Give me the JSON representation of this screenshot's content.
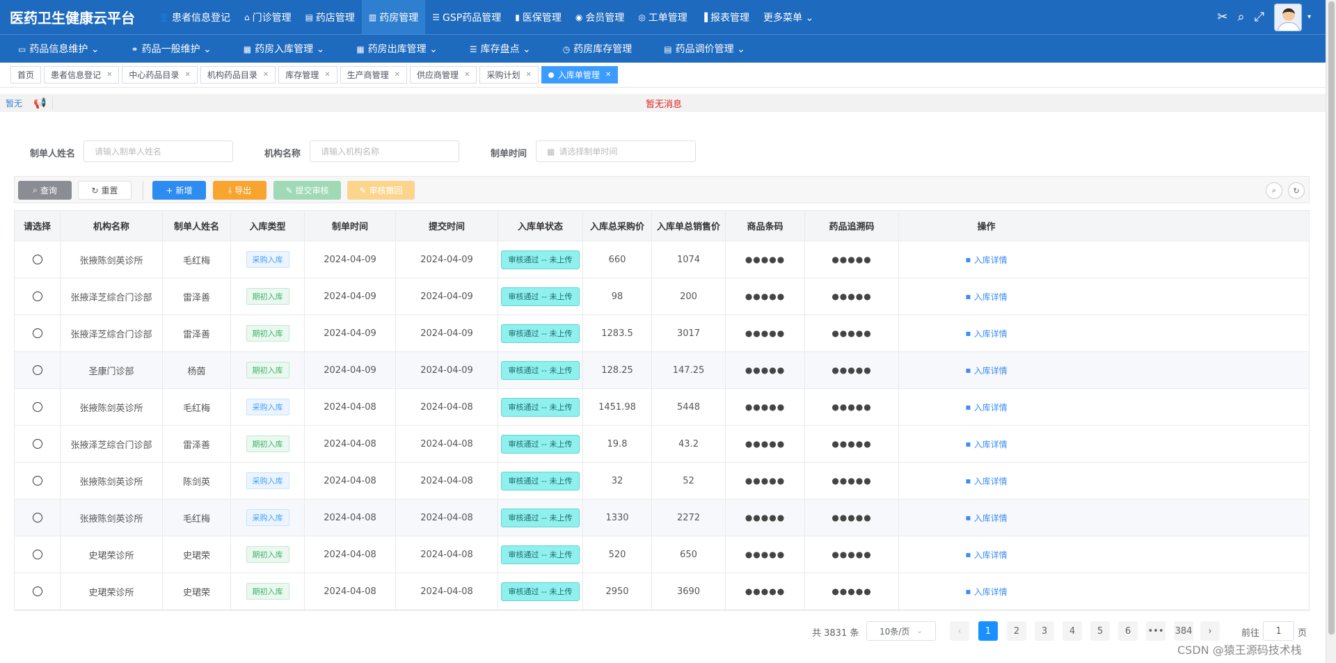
{
  "app": {
    "title": "医药卫生健康云平台"
  },
  "topnav": [
    {
      "icon": "user-icon",
      "glyph": "👤",
      "label": "患者信息登记"
    },
    {
      "icon": "clinic-icon",
      "glyph": "⌂",
      "label": "门诊管理"
    },
    {
      "icon": "store-icon",
      "glyph": "▤",
      "label": "药店管理"
    },
    {
      "icon": "pharmacy-icon",
      "glyph": "▥",
      "label": "药房管理"
    },
    {
      "icon": "list-icon",
      "glyph": "☰",
      "label": "GSP药品管理"
    },
    {
      "icon": "book-icon",
      "glyph": "▮",
      "label": "医保管理"
    },
    {
      "icon": "github-icon",
      "glyph": "◉",
      "label": "会员管理"
    },
    {
      "icon": "ticket-icon",
      "glyph": "◎",
      "label": "工单管理"
    },
    {
      "icon": "chart-icon",
      "glyph": "▐",
      "label": "报表管理"
    },
    {
      "icon": "",
      "glyph": "",
      "label": "更多菜单 ⌄"
    }
  ],
  "topnav_active_index": 3,
  "subnav": [
    {
      "icon": "▭",
      "label": "药品信息维护 ⌄"
    },
    {
      "icon": "⚭",
      "label": "药品一般维护 ⌄"
    },
    {
      "icon": "▦",
      "label": "药房入库管理 ⌄"
    },
    {
      "icon": "▦",
      "label": "药房出库管理 ⌄"
    },
    {
      "icon": "☰",
      "label": "库存盘点 ⌄"
    },
    {
      "icon": "◷",
      "label": "药房库存管理"
    },
    {
      "icon": "▤",
      "label": "药品调价管理 ⌄"
    }
  ],
  "tabs": [
    {
      "label": "首页",
      "closable": false
    },
    {
      "label": "患者信息登记",
      "closable": true
    },
    {
      "label": "中心药品目录",
      "closable": true
    },
    {
      "label": "机构药品目录",
      "closable": true
    },
    {
      "label": "库存管理",
      "closable": true
    },
    {
      "label": "生产商管理",
      "closable": true
    },
    {
      "label": "供应商管理",
      "closable": true
    },
    {
      "label": "采购计划",
      "closable": true
    },
    {
      "label": "入库单管理",
      "closable": true,
      "active": true
    }
  ],
  "notice": {
    "label": "暂无",
    "message": "暂无消息"
  },
  "form": {
    "creator_label": "制单人姓名",
    "creator_placeholder": "请输入制单人姓名",
    "org_label": "机构名称",
    "org_placeholder": "请输入机构名称",
    "time_label": "制单时间",
    "time_placeholder": "请选择制单时间"
  },
  "toolbar": {
    "query": "查询",
    "reset": "重置",
    "add": "新增",
    "export": "导出",
    "submit": "提交审核",
    "revoke": "审核撤回"
  },
  "table": {
    "columns": [
      "请选择",
      "机构名称",
      "制单人姓名",
      "入库类型",
      "制单时间",
      "提交时间",
      "入库单状态",
      "入库总采购价",
      "入库单总销售价",
      "商品条码",
      "药品追溯码",
      "操作"
    ],
    "rows": [
      {
        "org": "张掖陈剑英诊所",
        "creator": "毛红梅",
        "type": "采购入库",
        "type_kind": "buy",
        "created": "2024-04-09",
        "submitted": "2024-04-09",
        "status": "审核通过 -- 未上传",
        "purchase": "660",
        "sale": "1074",
        "barcode": "●●●●●",
        "trace": "●●●●●",
        "action": "入库详情"
      },
      {
        "org": "张掖泽芝综合门诊部",
        "creator": "雷泽善",
        "type": "期初入库",
        "type_kind": "init",
        "created": "2024-04-09",
        "submitted": "2024-04-09",
        "status": "审核通过 -- 未上传",
        "purchase": "98",
        "sale": "200",
        "barcode": "●●●●●",
        "trace": "●●●●●",
        "action": "入库详情"
      },
      {
        "org": "张掖泽芝综合门诊部",
        "creator": "雷泽善",
        "type": "期初入库",
        "type_kind": "init",
        "created": "2024-04-09",
        "submitted": "2024-04-09",
        "status": "审核通过 -- 未上传",
        "purchase": "1283.5",
        "sale": "3017",
        "barcode": "●●●●●",
        "trace": "●●●●●",
        "action": "入库详情"
      },
      {
        "org": "圣康门诊部",
        "creator": "杨茵",
        "type": "期初入库",
        "type_kind": "init",
        "created": "2024-04-09",
        "submitted": "2024-04-09",
        "status": "审核通过 -- 未上传",
        "purchase": "128.25",
        "sale": "147.25",
        "barcode": "●●●●●",
        "trace": "●●●●●",
        "action": "入库详情"
      },
      {
        "org": "张掖陈剑英诊所",
        "creator": "毛红梅",
        "type": "采购入库",
        "type_kind": "buy",
        "created": "2024-04-08",
        "submitted": "2024-04-08",
        "status": "审核通过 -- 未上传",
        "purchase": "1451.98",
        "sale": "5448",
        "barcode": "●●●●●",
        "trace": "●●●●●",
        "action": "入库详情"
      },
      {
        "org": "张掖泽芝综合门诊部",
        "creator": "雷泽善",
        "type": "期初入库",
        "type_kind": "init",
        "created": "2024-04-08",
        "submitted": "2024-04-08",
        "status": "审核通过 -- 未上传",
        "purchase": "19.8",
        "sale": "43.2",
        "barcode": "●●●●●",
        "trace": "●●●●●",
        "action": "入库详情"
      },
      {
        "org": "张掖陈剑英诊所",
        "creator": "陈剑英",
        "type": "采购入库",
        "type_kind": "buy",
        "created": "2024-04-08",
        "submitted": "2024-04-08",
        "status": "审核通过 -- 未上传",
        "purchase": "32",
        "sale": "52",
        "barcode": "●●●●●",
        "trace": "●●●●●",
        "action": "入库详情"
      },
      {
        "org": "张掖陈剑英诊所",
        "creator": "毛红梅",
        "type": "采购入库",
        "type_kind": "buy",
        "created": "2024-04-08",
        "submitted": "2024-04-08",
        "status": "审核通过 -- 未上传",
        "purchase": "1330",
        "sale": "2272",
        "barcode": "●●●●●",
        "trace": "●●●●●",
        "action": "入库详情"
      },
      {
        "org": "史珺荣诊所",
        "creator": "史珺荣",
        "type": "期初入库",
        "type_kind": "init",
        "created": "2024-04-08",
        "submitted": "2024-04-08",
        "status": "审核通过 -- 未上传",
        "purchase": "520",
        "sale": "650",
        "barcode": "●●●●●",
        "trace": "●●●●●",
        "action": "入库详情"
      },
      {
        "org": "史珺荣诊所",
        "creator": "史珺荣",
        "type": "期初入库",
        "type_kind": "init",
        "created": "2024-04-08",
        "submitted": "2024-04-08",
        "status": "审核通过 -- 未上传",
        "purchase": "2950",
        "sale": "3690",
        "barcode": "●●●●●",
        "trace": "●●●●●",
        "action": "入库详情"
      }
    ]
  },
  "pagination": {
    "total": "共 3831 条",
    "page_size": "10条/页",
    "pages": [
      "1",
      "2",
      "3",
      "4",
      "5",
      "6",
      "•••",
      "384"
    ],
    "current": "1",
    "goto_label": "前往",
    "goto_value": "1",
    "page_suffix": "页"
  },
  "footer_watermark": "CSDN @猿王源码技术栈",
  "colors": {
    "nav": "#1e6abe",
    "primary": "#2d8cf0",
    "warning": "#f7a52f",
    "status": "#8ff0ee"
  }
}
